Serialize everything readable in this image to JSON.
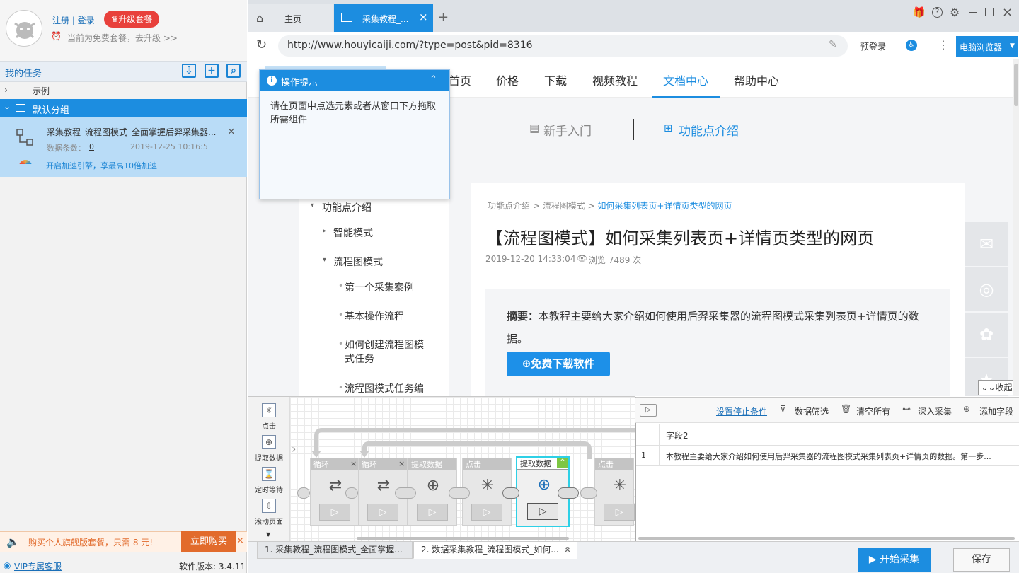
{
  "sidebar": {
    "register_login": "注册 | 登录",
    "upgrade_badge": "升级套餐",
    "plan_notice": "当前为免费套餐，去升级 >>",
    "my_tasks": "我的任务",
    "groups": [
      {
        "label": "示例",
        "expanded": false
      },
      {
        "label": "默认分组",
        "expanded": true
      }
    ],
    "task": {
      "title": "采集教程_流程图模式_全面掌握后羿采集器...",
      "count_label": "数据条数：",
      "count_value": "0",
      "time": "2019-12-25 10:16:5",
      "accel": "开启加速引擎，享最高10倍加速"
    },
    "promo": "购买个人旗舰版套餐，只需 8 元!",
    "buy_button": "立即购买",
    "vip_link": "VIP专属客服",
    "version": "软件版本: 3.4.11"
  },
  "tabs": [
    {
      "label": "主页",
      "icon": "home-icon"
    },
    {
      "label": "采集教程_...",
      "icon": "window-icon",
      "active": true
    }
  ],
  "address": {
    "url": "http://www.houyicaiji.com/?type=post&pid=8316",
    "prelogin": "预登录",
    "browser_select": "电脑浏览器"
  },
  "site_nav": {
    "items": [
      "首页",
      "价格",
      "下载",
      "视频教程",
      "文档中心",
      "帮助中心"
    ],
    "active": "文档中心"
  },
  "subnav": {
    "left": "新手入门",
    "right": "功能点介绍"
  },
  "left_menu": [
    {
      "label": "功能点介绍",
      "level": 0,
      "arrow": "▾"
    },
    {
      "label": "智能模式",
      "level": 1,
      "arrow": "▸"
    },
    {
      "label": "流程图模式",
      "level": 1,
      "arrow": "▾"
    },
    {
      "label": "第一个采集案例",
      "level": 2
    },
    {
      "label": "基本操作流程",
      "level": 2
    },
    {
      "label": "如何创建流程图模式任务",
      "level": 2
    },
    {
      "label": "流程图模式任务编",
      "level": 2
    }
  ],
  "article": {
    "breadcrumb1": "功能点介绍",
    "breadcrumb2": "流程图模式",
    "breadcrumb3": "如何采集列表页+详情页类型的网页",
    "title": "【流程图模式】如何采集列表页+详情页类型的网页",
    "date": "2019-12-20 14:33:04",
    "views": "浏览 7489 次",
    "summary_label": "摘要：",
    "summary_text": "本教程主要给大家介绍如何使用后羿采集器的流程图模式采集列表页+详情页的数据。",
    "download_button": "免费下载软件",
    "collapse": "收起"
  },
  "tip": {
    "title": "操作提示",
    "body": "请在页面中点选元素或者从窗口下方拖取所需组件"
  },
  "palette": [
    {
      "label": "点击",
      "icon": "click-icon"
    },
    {
      "label": "提取数据",
      "icon": "extract-icon"
    },
    {
      "label": "定时等待",
      "icon": "hourglass-icon"
    },
    {
      "label": "滚动页面",
      "icon": "scroll-icon"
    }
  ],
  "flow_nodes": [
    {
      "label": "循环",
      "icon": "⇄",
      "close": "×"
    },
    {
      "label": "循环",
      "icon": "⇄",
      "close": "×"
    },
    {
      "label": "提取数据",
      "icon": "⊕"
    },
    {
      "label": "点击",
      "icon": "✳"
    },
    {
      "label": "提取数据",
      "icon": "⊕",
      "selected": true,
      "close": "^"
    },
    {
      "label": "点击",
      "icon": "✳"
    }
  ],
  "data_panel": {
    "toolbar": [
      "设置停止条件",
      "数据筛选",
      "清空所有",
      "深入采集",
      "添加字段"
    ],
    "column": "字段2",
    "row_index": "1",
    "row_value": "本教程主要给大家介绍如何使用后羿采集器的流程图模式采集列表页+详情页的数据。第一步..."
  },
  "bottom": {
    "tab1": "1. 采集教程_流程图模式_全面掌握...",
    "tab2": "2. 数据采集教程_流程图模式_如何...",
    "start": "开始采集",
    "save": "保存"
  }
}
